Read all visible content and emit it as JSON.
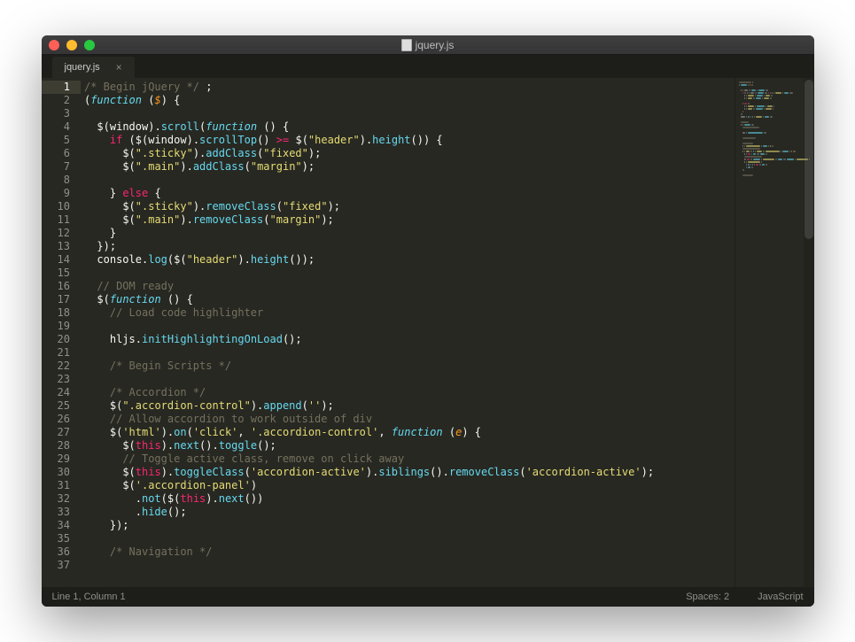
{
  "window": {
    "title": "jquery.js"
  },
  "tab": {
    "label": "jquery.js"
  },
  "code": {
    "lines": [
      {
        "n": 1,
        "tokens": [
          [
            "comment",
            "/* Begin jQuery */"
          ],
          [
            "punct",
            " ;"
          ]
        ]
      },
      {
        "n": 2,
        "tokens": [
          [
            "punct",
            "("
          ],
          [
            "func",
            "function "
          ],
          [
            "punct",
            "("
          ],
          [
            "param",
            "$"
          ],
          [
            "punct",
            ") {"
          ]
        ]
      },
      {
        "n": 3,
        "tokens": []
      },
      {
        "n": 4,
        "tokens": [
          [
            "indent",
            "  "
          ],
          [
            "var",
            "$"
          ],
          [
            "punct",
            "("
          ],
          [
            "var",
            "window"
          ],
          [
            "punct",
            ")."
          ],
          [
            "call",
            "scroll"
          ],
          [
            "punct",
            "("
          ],
          [
            "func",
            "function "
          ],
          [
            "punct",
            "() {"
          ]
        ]
      },
      {
        "n": 5,
        "tokens": [
          [
            "indent",
            "    "
          ],
          [
            "keyword",
            "if"
          ],
          [
            "punct",
            " ("
          ],
          [
            "var",
            "$"
          ],
          [
            "punct",
            "("
          ],
          [
            "var",
            "window"
          ],
          [
            "punct",
            ")."
          ],
          [
            "call",
            "scrollTop"
          ],
          [
            "punct",
            "() "
          ],
          [
            "keyword",
            ">="
          ],
          [
            "punct",
            " "
          ],
          [
            "var",
            "$"
          ],
          [
            "punct",
            "("
          ],
          [
            "string",
            "\"header\""
          ],
          [
            "punct",
            ")."
          ],
          [
            "call",
            "height"
          ],
          [
            "punct",
            "()) {"
          ]
        ]
      },
      {
        "n": 6,
        "tokens": [
          [
            "indent",
            "      "
          ],
          [
            "var",
            "$"
          ],
          [
            "punct",
            "("
          ],
          [
            "string",
            "\".sticky\""
          ],
          [
            "punct",
            ")."
          ],
          [
            "call",
            "addClass"
          ],
          [
            "punct",
            "("
          ],
          [
            "string",
            "\"fixed\""
          ],
          [
            "punct",
            ");"
          ]
        ]
      },
      {
        "n": 7,
        "tokens": [
          [
            "indent",
            "      "
          ],
          [
            "var",
            "$"
          ],
          [
            "punct",
            "("
          ],
          [
            "string",
            "\".main\""
          ],
          [
            "punct",
            ")."
          ],
          [
            "call",
            "addClass"
          ],
          [
            "punct",
            "("
          ],
          [
            "string",
            "\"margin\""
          ],
          [
            "punct",
            ");"
          ]
        ]
      },
      {
        "n": 8,
        "tokens": []
      },
      {
        "n": 9,
        "tokens": [
          [
            "indent",
            "    "
          ],
          [
            "punct",
            "} "
          ],
          [
            "keyword",
            "else"
          ],
          [
            "punct",
            " {"
          ]
        ]
      },
      {
        "n": 10,
        "tokens": [
          [
            "indent",
            "      "
          ],
          [
            "var",
            "$"
          ],
          [
            "punct",
            "("
          ],
          [
            "string",
            "\".sticky\""
          ],
          [
            "punct",
            ")."
          ],
          [
            "call",
            "removeClass"
          ],
          [
            "punct",
            "("
          ],
          [
            "string",
            "\"fixed\""
          ],
          [
            "punct",
            ");"
          ]
        ]
      },
      {
        "n": 11,
        "tokens": [
          [
            "indent",
            "      "
          ],
          [
            "var",
            "$"
          ],
          [
            "punct",
            "("
          ],
          [
            "string",
            "\".main\""
          ],
          [
            "punct",
            ")."
          ],
          [
            "call",
            "removeClass"
          ],
          [
            "punct",
            "("
          ],
          [
            "string",
            "\"margin\""
          ],
          [
            "punct",
            ");"
          ]
        ]
      },
      {
        "n": 12,
        "tokens": [
          [
            "indent",
            "    "
          ],
          [
            "punct",
            "}"
          ]
        ]
      },
      {
        "n": 13,
        "tokens": [
          [
            "indent",
            "  "
          ],
          [
            "punct",
            "});"
          ]
        ]
      },
      {
        "n": 14,
        "tokens": [
          [
            "indent",
            "  "
          ],
          [
            "var",
            "console"
          ],
          [
            "punct",
            "."
          ],
          [
            "call",
            "log"
          ],
          [
            "punct",
            "("
          ],
          [
            "var",
            "$"
          ],
          [
            "punct",
            "("
          ],
          [
            "string",
            "\"header\""
          ],
          [
            "punct",
            ")."
          ],
          [
            "call",
            "height"
          ],
          [
            "punct",
            "());"
          ]
        ]
      },
      {
        "n": 15,
        "tokens": []
      },
      {
        "n": 16,
        "tokens": [
          [
            "indent",
            "  "
          ],
          [
            "comment",
            "// DOM ready"
          ]
        ]
      },
      {
        "n": 17,
        "tokens": [
          [
            "indent",
            "  "
          ],
          [
            "var",
            "$"
          ],
          [
            "punct",
            "("
          ],
          [
            "func",
            "function "
          ],
          [
            "punct",
            "() {"
          ]
        ]
      },
      {
        "n": 18,
        "tokens": [
          [
            "indent",
            "    "
          ],
          [
            "comment",
            "// Load code highlighter"
          ]
        ]
      },
      {
        "n": 19,
        "tokens": []
      },
      {
        "n": 20,
        "tokens": [
          [
            "indent",
            "    "
          ],
          [
            "var",
            "hljs"
          ],
          [
            "punct",
            "."
          ],
          [
            "call",
            "initHighlightingOnLoad"
          ],
          [
            "punct",
            "();"
          ]
        ]
      },
      {
        "n": 21,
        "tokens": []
      },
      {
        "n": 22,
        "tokens": [
          [
            "indent",
            "    "
          ],
          [
            "comment",
            "/* Begin Scripts */"
          ]
        ]
      },
      {
        "n": 23,
        "tokens": []
      },
      {
        "n": 24,
        "tokens": [
          [
            "indent",
            "    "
          ],
          [
            "comment",
            "/* Accordion */"
          ]
        ]
      },
      {
        "n": 25,
        "tokens": [
          [
            "indent",
            "    "
          ],
          [
            "var",
            "$"
          ],
          [
            "punct",
            "("
          ],
          [
            "string",
            "\".accordion-control\""
          ],
          [
            "punct",
            ")."
          ],
          [
            "call",
            "append"
          ],
          [
            "punct",
            "("
          ],
          [
            "string",
            "''"
          ],
          [
            "punct",
            ");"
          ]
        ]
      },
      {
        "n": 26,
        "tokens": [
          [
            "indent",
            "    "
          ],
          [
            "comment",
            "// Allow accordion to work outside of div"
          ]
        ]
      },
      {
        "n": 27,
        "tokens": [
          [
            "indent",
            "    "
          ],
          [
            "var",
            "$"
          ],
          [
            "punct",
            "("
          ],
          [
            "string",
            "'html'"
          ],
          [
            "punct",
            ")."
          ],
          [
            "call",
            "on"
          ],
          [
            "punct",
            "("
          ],
          [
            "string",
            "'click'"
          ],
          [
            "punct",
            ", "
          ],
          [
            "string",
            "'.accordion-control'"
          ],
          [
            "punct",
            ", "
          ],
          [
            "func",
            "function "
          ],
          [
            "punct",
            "("
          ],
          [
            "param",
            "e"
          ],
          [
            "punct",
            ") {"
          ]
        ]
      },
      {
        "n": 28,
        "tokens": [
          [
            "indent",
            "      "
          ],
          [
            "var",
            "$"
          ],
          [
            "punct",
            "("
          ],
          [
            "keyword",
            "this"
          ],
          [
            "punct",
            ")."
          ],
          [
            "call",
            "next"
          ],
          [
            "punct",
            "()."
          ],
          [
            "call",
            "toggle"
          ],
          [
            "punct",
            "();"
          ]
        ]
      },
      {
        "n": 29,
        "tokens": [
          [
            "indent",
            "      "
          ],
          [
            "comment",
            "// Toggle active class, remove on click away"
          ]
        ]
      },
      {
        "n": 30,
        "tokens": [
          [
            "indent",
            "      "
          ],
          [
            "var",
            "$"
          ],
          [
            "punct",
            "("
          ],
          [
            "keyword",
            "this"
          ],
          [
            "punct",
            ")."
          ],
          [
            "call",
            "toggleClass"
          ],
          [
            "punct",
            "("
          ],
          [
            "string",
            "'accordion-active'"
          ],
          [
            "punct",
            ")."
          ],
          [
            "call",
            "siblings"
          ],
          [
            "punct",
            "()."
          ],
          [
            "call",
            "removeClass"
          ],
          [
            "punct",
            "("
          ],
          [
            "string",
            "'accordion-active'"
          ],
          [
            "punct",
            ");"
          ]
        ]
      },
      {
        "n": 31,
        "tokens": [
          [
            "indent",
            "      "
          ],
          [
            "var",
            "$"
          ],
          [
            "punct",
            "("
          ],
          [
            "string",
            "'.accordion-panel'"
          ],
          [
            "punct",
            ")"
          ]
        ]
      },
      {
        "n": 32,
        "tokens": [
          [
            "indent",
            "        "
          ],
          [
            "punct",
            "."
          ],
          [
            "call",
            "not"
          ],
          [
            "punct",
            "("
          ],
          [
            "var",
            "$"
          ],
          [
            "punct",
            "("
          ],
          [
            "keyword",
            "this"
          ],
          [
            "punct",
            ")."
          ],
          [
            "call",
            "next"
          ],
          [
            "punct",
            "())"
          ]
        ]
      },
      {
        "n": 33,
        "tokens": [
          [
            "indent",
            "        "
          ],
          [
            "punct",
            "."
          ],
          [
            "call",
            "hide"
          ],
          [
            "punct",
            "();"
          ]
        ]
      },
      {
        "n": 34,
        "tokens": [
          [
            "indent",
            "    "
          ],
          [
            "punct",
            "});"
          ]
        ]
      },
      {
        "n": 35,
        "tokens": []
      },
      {
        "n": 36,
        "tokens": [
          [
            "indent",
            "    "
          ],
          [
            "comment",
            "/* Navigation */"
          ]
        ]
      },
      {
        "n": 37,
        "tokens": []
      }
    ],
    "active_line": 1
  },
  "status": {
    "left": "Line 1, Column 1",
    "indent": "Spaces: 2",
    "language": "JavaScript"
  }
}
